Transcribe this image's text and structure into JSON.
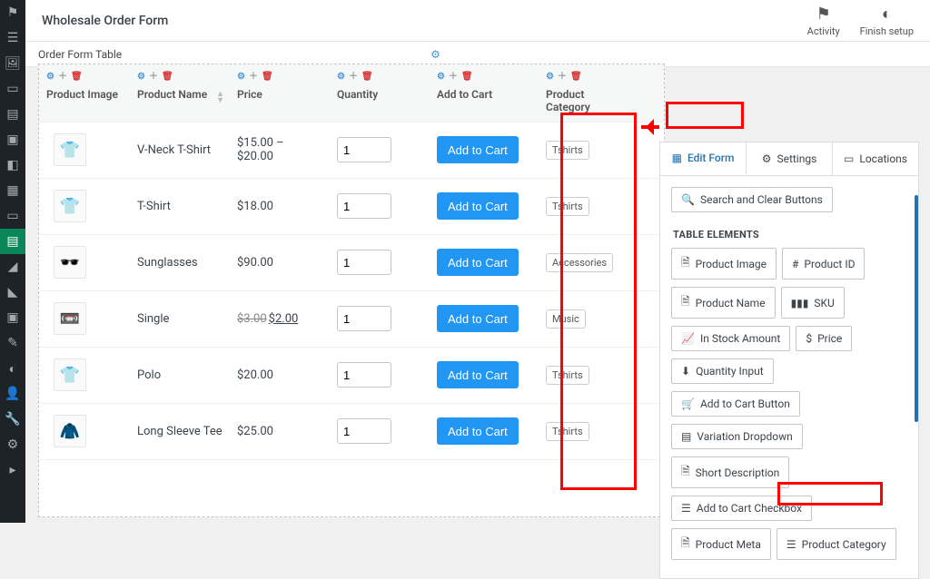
{
  "topbar": {
    "title": "Wholesale Order Form",
    "actions": {
      "activity": "Activity",
      "finish": "Finish setup"
    }
  },
  "tabbar": {
    "label": "Order Form Table"
  },
  "columns": {
    "image": "Product Image",
    "name": "Product Name",
    "price": "Price",
    "qty": "Quantity",
    "cart": "Add to Cart",
    "category": "Product Category"
  },
  "add_to_cart_label": "Add to Cart",
  "rows": [
    {
      "emoji": "👕",
      "name": "V-Neck T-Shirt",
      "price": "$15.00 – $20.00",
      "qty": "1",
      "category": "Tshirts"
    },
    {
      "emoji": "👕",
      "name": "T-Shirt",
      "price": "$18.00",
      "qty": "1",
      "category": "Tshirts"
    },
    {
      "emoji": "🕶️",
      "name": "Sunglasses",
      "price": "$90.00",
      "qty": "1",
      "category": "Accessories"
    },
    {
      "emoji": "📼",
      "name": "Single",
      "price_old": "$3.00",
      "price": "$2.00",
      "qty": "1",
      "category": "Music"
    },
    {
      "emoji": "👕",
      "name": "Polo",
      "price": "$20.00",
      "qty": "1",
      "category": "Tshirts"
    },
    {
      "emoji": "🧥",
      "name": "Long Sleeve Tee",
      "price": "$25.00",
      "qty": "1",
      "category": "Tshirts"
    }
  ],
  "panel": {
    "tabs": {
      "edit": "Edit Form",
      "settings": "Settings",
      "locations": "Locations"
    },
    "section_title": "TABLE ELEMENTS",
    "search_btn": "Search and Clear Buttons",
    "elements": {
      "product_image": "Product Image",
      "product_id": "Product ID",
      "product_name": "Product Name",
      "sku": "SKU",
      "in_stock": "In Stock Amount",
      "price": "Price",
      "qty_input": "Quantity Input",
      "add_to_cart_btn": "Add to Cart Button",
      "variation": "Variation Dropdown",
      "short_desc": "Short Description",
      "cart_checkbox": "Add to Cart Checkbox",
      "product_meta": "Product Meta",
      "product_category": "Product Category"
    }
  }
}
